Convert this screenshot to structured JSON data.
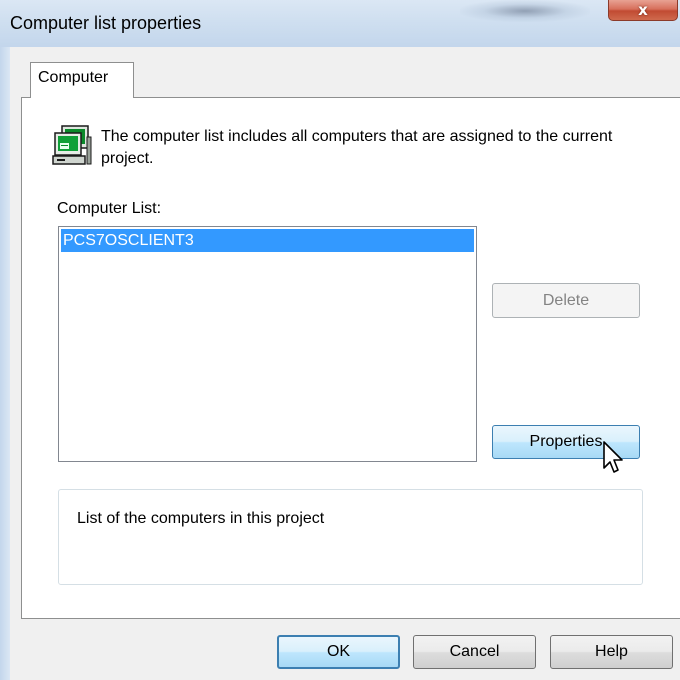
{
  "window": {
    "title": "Computer list properties",
    "close_glyph": "x"
  },
  "tabs": [
    {
      "label": "Computer",
      "active": true
    }
  ],
  "panel": {
    "icon": "computer-icon",
    "description": "The computer list includes all computers that are assigned to the current project.",
    "list_label": "Computer List:",
    "list_items": [
      {
        "name": "PCS7OSCLIENT3",
        "selected": true
      }
    ],
    "delete_label": "Delete",
    "delete_enabled": false,
    "properties_label": "Properties",
    "info_text": "List of the computers in this project"
  },
  "footer": {
    "ok_label": "OK",
    "cancel_label": "Cancel",
    "help_label": "Help"
  },
  "colors": {
    "selection": "#3399ff",
    "hover_button": "#bee6fd",
    "close_button": "#c14b33"
  }
}
